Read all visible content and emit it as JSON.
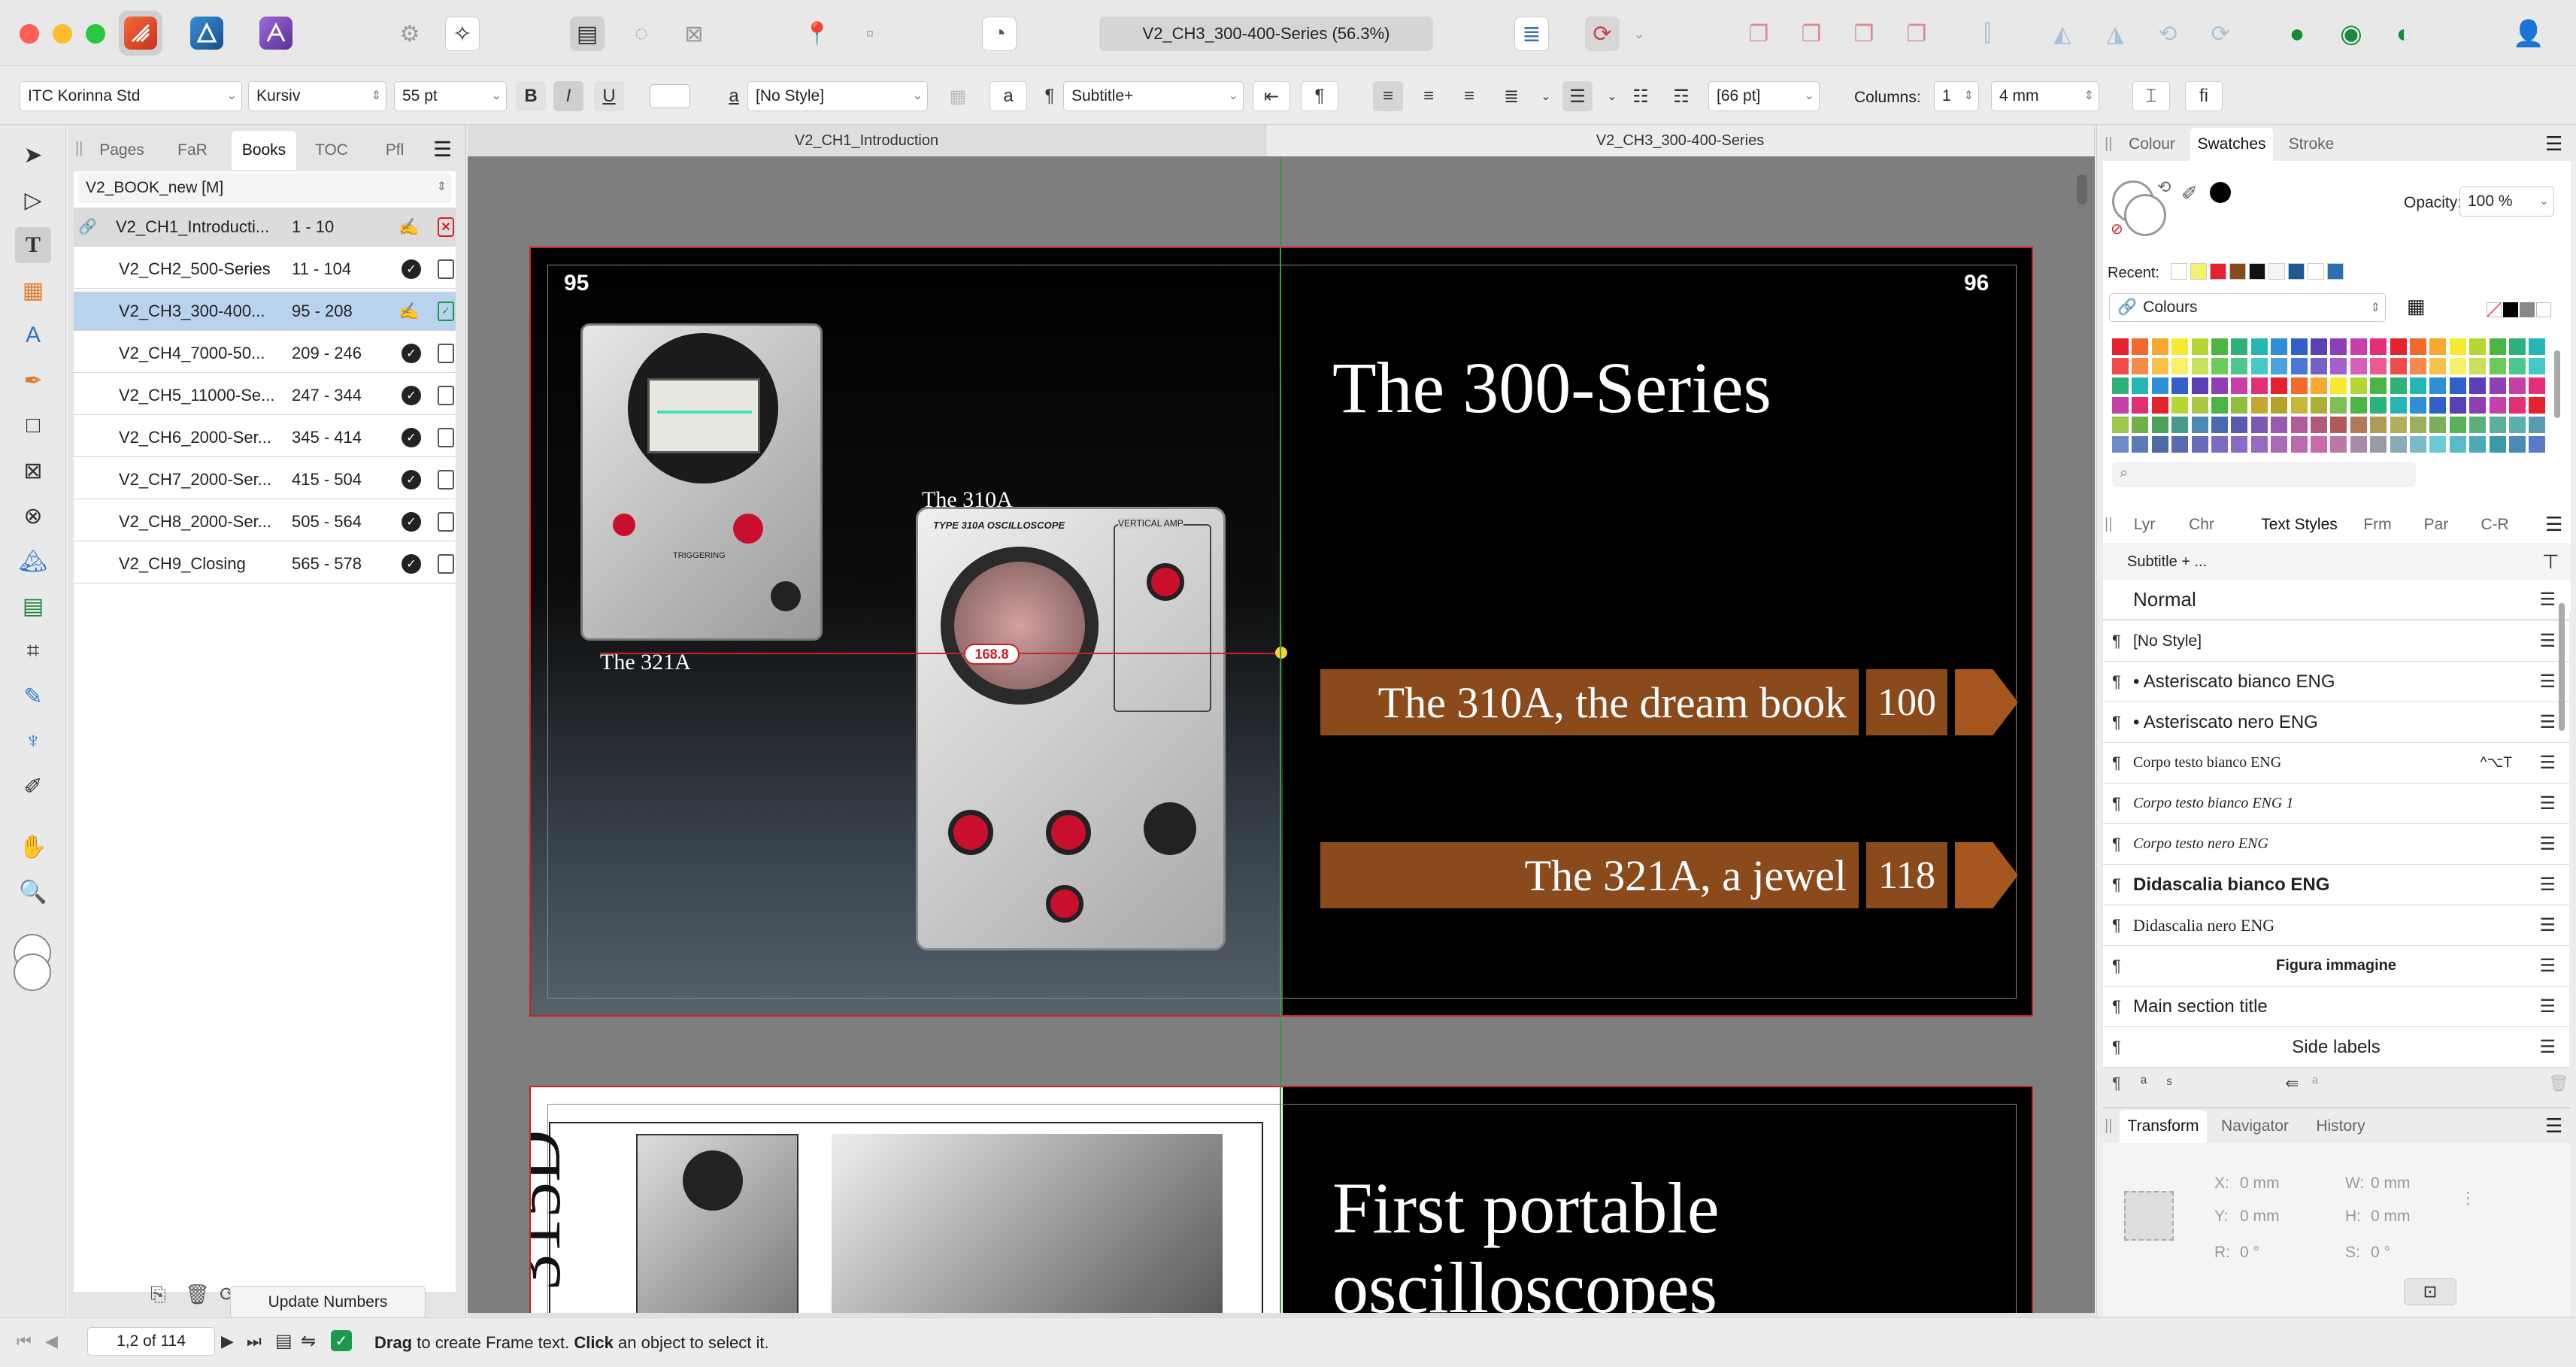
{
  "window": {
    "title": "V2_CH3_300-400-Series (56.3%)"
  },
  "context_toolbar": {
    "font_family": "ITC Korinna Std",
    "font_style": "Kursiv",
    "font_size": "55 pt",
    "bold": "B",
    "italic": "I",
    "underline": "U",
    "char_style": "[No Style]",
    "para_style": "Subtitle+",
    "leading": "[66 pt]",
    "columns_label": "Columns:",
    "columns_value": "1",
    "gutter_value": "4 mm",
    "a_glyph": "a",
    "pilcrow": "¶",
    "fi_glyph": "fi"
  },
  "left_panel": {
    "tabs": [
      "Pages",
      "FaR",
      "Books",
      "TOC",
      "Pfl"
    ],
    "active_tab": "Books",
    "book_name": "V2_BOOK_new [M]",
    "chapters": [
      {
        "name": "V2_CH1_Introducti...",
        "range": "1 - 10",
        "status": "error"
      },
      {
        "name": "V2_CH2_500-Series",
        "range": "11 - 104",
        "status": "ok"
      },
      {
        "name": "V2_CH3_300-400...",
        "range": "95 - 208",
        "status": "open"
      },
      {
        "name": "V2_CH4_7000-50...",
        "range": "209 - 246",
        "status": "ok"
      },
      {
        "name": "V2_CH5_11000-Se...",
        "range": "247 - 344",
        "status": "ok"
      },
      {
        "name": "V2_CH6_2000-Ser...",
        "range": "345 - 414",
        "status": "ok"
      },
      {
        "name": "V2_CH7_2000-Ser...",
        "range": "415 - 504",
        "status": "ok"
      },
      {
        "name": "V2_CH8_2000-Ser...",
        "range": "505 - 564",
        "status": "ok"
      },
      {
        "name": "V2_CH9_Closing",
        "range": "565 - 578",
        "status": "ok"
      }
    ],
    "update_button": "Update Numbers"
  },
  "document": {
    "tabs": [
      "V2_CH1_Introduction",
      "V2_CH3_300-400-Series"
    ],
    "page_left_number": "95",
    "page_right_number": "96",
    "heading": "The 300-Series",
    "label_310a": "The 310A",
    "label_321a": "The 321A",
    "measure": "168.8",
    "scope_310a_brand": "TYPE 310A OSCILLOSCOPE",
    "scope_310a_section": "VERTICAL AMP",
    "scope_321a_section": "TRIGGERING",
    "banners": [
      {
        "text": "The 310A, the dream book",
        "page": "100"
      },
      {
        "text": "The 321A, a jewel",
        "page": "118"
      }
    ],
    "second_spread_vertical": "315D",
    "second_spread_heading": "First portable oscilloscopes"
  },
  "right_panel": {
    "colour_tabs": [
      "Colour",
      "Swatches",
      "Stroke"
    ],
    "active_colour_tab": "Swatches",
    "opacity_label": "Opacity:",
    "opacity_value": "100 %",
    "recent_label": "Recent:",
    "palette_name": "Colours",
    "style_tabs": [
      "Lyr",
      "Chr",
      "Text Styles",
      "Frm",
      "Par",
      "C-R"
    ],
    "active_style_tab": "Text Styles",
    "style_breadcrumb": "Subtitle + ...",
    "styles": [
      {
        "name": "Normal",
        "shortcut": ""
      },
      {
        "name": "[No Style]",
        "shortcut": ""
      },
      {
        "name": "• Asteriscato bianco ENG",
        "shortcut": ""
      },
      {
        "name": "• Asteriscato nero ENG",
        "shortcut": ""
      },
      {
        "name": "Corpo testo bianco ENG",
        "shortcut": "^⌥T"
      },
      {
        "name": "Corpo testo bianco ENG 1",
        "shortcut": ""
      },
      {
        "name": "Corpo testo nero ENG",
        "shortcut": ""
      },
      {
        "name": "Didascalia bianco ENG",
        "shortcut": ""
      },
      {
        "name": "Didascalia nero ENG",
        "shortcut": ""
      },
      {
        "name": "Figura immagine",
        "shortcut": ""
      },
      {
        "name": "Main section title",
        "shortcut": ""
      },
      {
        "name": "Side labels",
        "shortcut": ""
      }
    ],
    "transform_tabs": [
      "Transform",
      "Navigator",
      "History"
    ],
    "active_transform_tab": "Transform",
    "transform": {
      "x_label": "X:",
      "x": "0 mm",
      "y_label": "Y:",
      "y": "0 mm",
      "w_label": "W:",
      "w": "0 mm",
      "h_label": "H:",
      "h": "0 mm",
      "r_label": "R:",
      "r": "0 °",
      "s_label": "S:",
      "s": "0 °"
    }
  },
  "statusbar": {
    "page_indicator": "1,2 of 114",
    "hint_drag": "Drag",
    "hint_1": " to create Frame text. ",
    "hint_click": "Click",
    "hint_2": " an object to select it."
  },
  "colors": {
    "banner_brown": "#8a4a1c",
    "banner_arrow": "#a5561f",
    "page_border_red": "#cc2222",
    "selection_blue": "#b9d3ee",
    "guide_green": "#3a9a3a"
  }
}
